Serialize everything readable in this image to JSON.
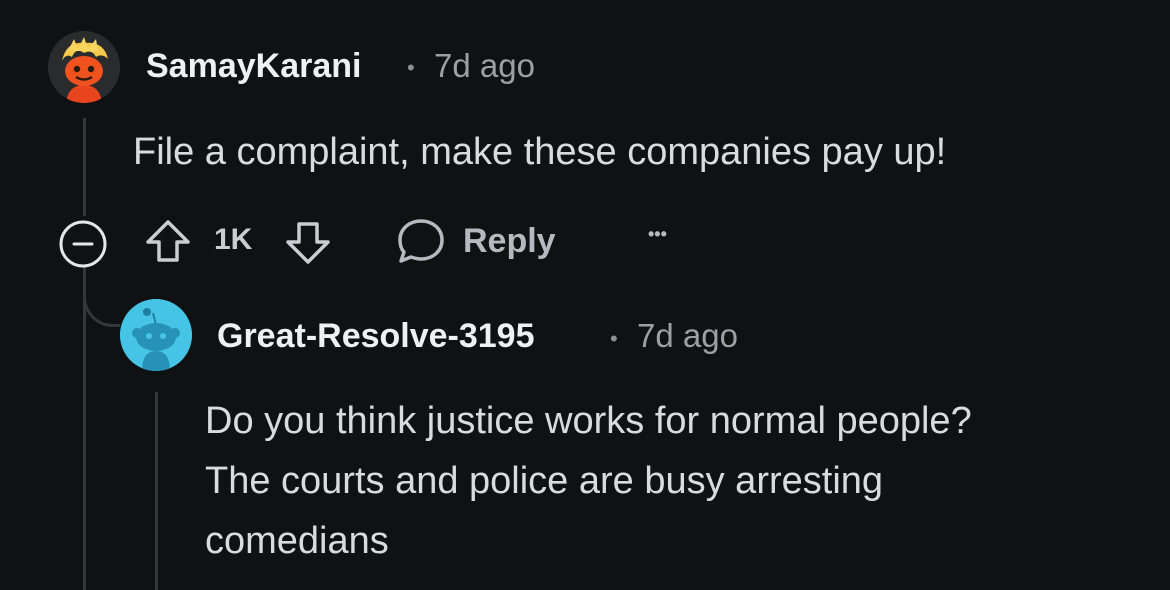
{
  "comment": {
    "username": "SamayKarani",
    "separator": "•",
    "time": "7d ago",
    "text": "File a complaint, make these companies pay up!",
    "vote_count": "1K",
    "reply_label": "Reply",
    "more_label": "•••"
  },
  "reply": {
    "username": "Great-Resolve-3195",
    "separator": "•",
    "time": "7d ago",
    "text_lines": [
      "Do you think justice works for normal people?",
      "The courts and police are busy arresting",
      "comedians"
    ]
  },
  "colors": {
    "background": "#0f1113",
    "reply_avatar_bg": "#45c4e6",
    "thread_line": "#33383c"
  }
}
